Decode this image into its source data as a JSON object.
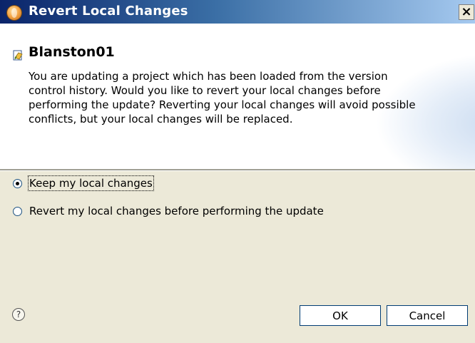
{
  "window": {
    "title": "Revert Local Changes",
    "close_label": "✕"
  },
  "icons": {
    "app": "eclipse-orb-icon",
    "project": "project-file-icon",
    "help": "help-icon",
    "close": "close-icon"
  },
  "header": {
    "project_name": "Blanston01",
    "description": "You are updating a project which has been loaded from the version control history.  Would you like to revert your local changes before performing the update? Reverting your local changes will avoid possible conflicts, but your local changes will be replaced."
  },
  "options": [
    {
      "label": "Keep my local changes",
      "selected": true
    },
    {
      "label": "Revert my local changes before performing the update",
      "selected": false
    }
  ],
  "footer": {
    "help_glyph": "?",
    "ok_label": "OK",
    "cancel_label": "Cancel"
  }
}
